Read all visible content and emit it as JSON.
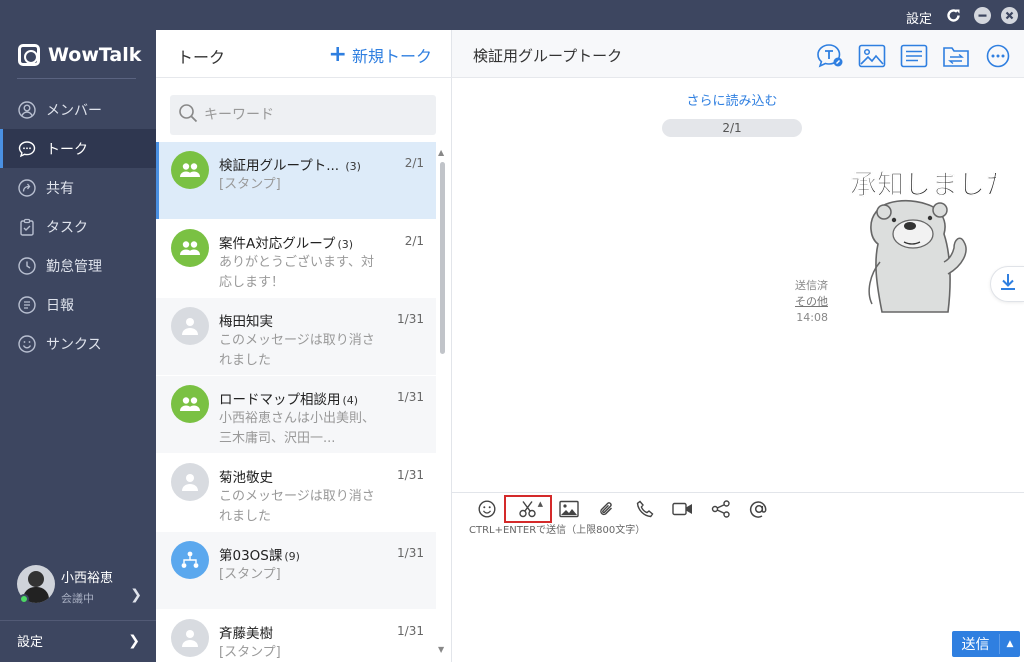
{
  "topbar": {
    "settings_label": "設定"
  },
  "sidebar": {
    "logo_text": "WowTalk",
    "items": [
      {
        "label": "メンバー",
        "icon": "person-icon"
      },
      {
        "label": "トーク",
        "icon": "chat-bubble-icon",
        "active": true
      },
      {
        "label": "共有",
        "icon": "share-icon"
      },
      {
        "label": "タスク",
        "icon": "clipboard-icon"
      },
      {
        "label": "勤怠管理",
        "icon": "clock-icon"
      },
      {
        "label": "日報",
        "icon": "report-icon"
      },
      {
        "label": "サンクス",
        "icon": "smile-icon"
      }
    ],
    "profile": {
      "name": "小西裕恵",
      "status": "会議中"
    },
    "settings_label": "設定"
  },
  "list": {
    "title": "トーク",
    "new_talk_label": "新規トーク",
    "search_placeholder": "キーワード",
    "items": [
      {
        "name": "検証用グループト...",
        "count": "(3)",
        "date": "2/1",
        "preview": "[スタンプ]",
        "avatar": "group-icon"
      },
      {
        "name": "案件A対応グループ",
        "count": "(3)",
        "date": "2/1",
        "preview": "ありがとうございます、対応します！",
        "avatar": "group-icon"
      },
      {
        "name": "梅田知実",
        "count": "",
        "date": "1/31",
        "preview": "このメッセージは取り消されました",
        "avatar": "person-icon"
      },
      {
        "name": "ロードマップ相談用",
        "count": "(4)",
        "date": "1/31",
        "preview": "小西裕恵さんは小出美則、三木庸司、沢田一...",
        "avatar": "group-icon"
      },
      {
        "name": "菊池敬史",
        "count": "",
        "date": "1/31",
        "preview": "このメッセージは取り消されました",
        "avatar": "person-icon"
      },
      {
        "name": "第03OS課",
        "count": "(9)",
        "date": "1/31",
        "preview": "[スタンプ]",
        "avatar": "org-icon"
      },
      {
        "name": "斉藤美樹",
        "count": "",
        "date": "1/31",
        "preview": "[スタンプ]",
        "avatar": "person-icon"
      }
    ]
  },
  "chat": {
    "title": "検証用グループトーク",
    "load_more": "さらに読み込む",
    "page_indicator": "2/1",
    "sticker_text": "承知しました",
    "sent_status": "送信済",
    "other_link": "その他",
    "time": "14:08",
    "compose_hint": "CTRL+ENTERで送信（上限800文字）",
    "send_label": "送信"
  }
}
